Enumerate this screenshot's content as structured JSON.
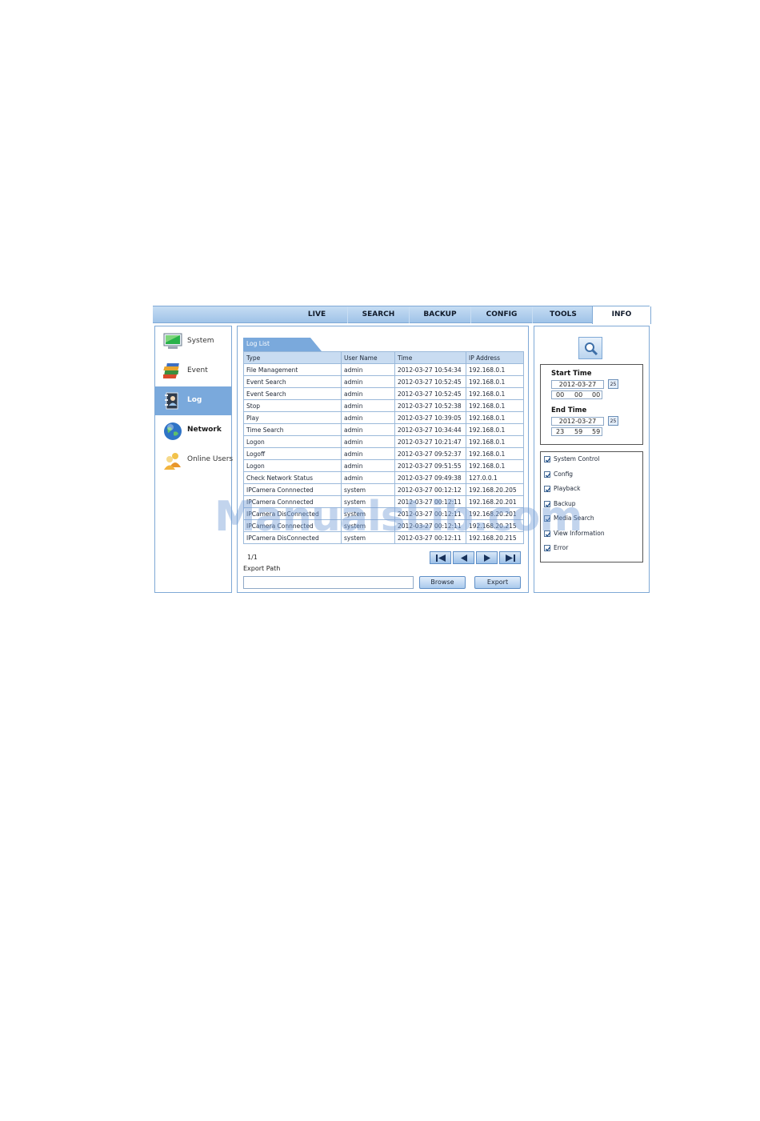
{
  "nav": {
    "tabs": [
      "LIVE",
      "SEARCH",
      "BACKUP",
      "CONFIG",
      "TOOLS",
      "INFO"
    ],
    "active_tab": "INFO"
  },
  "sidebar": {
    "items": [
      {
        "label": "System",
        "icon": "monitor-icon"
      },
      {
        "label": "Event",
        "icon": "books-icon"
      },
      {
        "label": "Log",
        "icon": "log-icon"
      },
      {
        "label": "Network",
        "icon": "globe-icon"
      },
      {
        "label": "Online Users",
        "icon": "users-icon"
      }
    ],
    "active": "Log"
  },
  "log": {
    "tab_label": "Log List",
    "columns": [
      "Type",
      "User Name",
      "Time",
      "IP Address"
    ],
    "rows": [
      [
        "File Management",
        "admin",
        "2012-03-27 10:54:34",
        "192.168.0.1"
      ],
      [
        "Event Search",
        "admin",
        "2012-03-27 10:52:45",
        "192.168.0.1"
      ],
      [
        "Event Search",
        "admin",
        "2012-03-27 10:52:45",
        "192.168.0.1"
      ],
      [
        "Stop",
        "admin",
        "2012-03-27 10:52:38",
        "192.168.0.1"
      ],
      [
        "Play",
        "admin",
        "2012-03-27 10:39:05",
        "192.168.0.1"
      ],
      [
        "Time Search",
        "admin",
        "2012-03-27 10:34:44",
        "192.168.0.1"
      ],
      [
        "Logon",
        "admin",
        "2012-03-27 10:21:47",
        "192.168.0.1"
      ],
      [
        "Logoff",
        "admin",
        "2012-03-27 09:52:37",
        "192.168.0.1"
      ],
      [
        "Logon",
        "admin",
        "2012-03-27 09:51:55",
        "192.168.0.1"
      ],
      [
        "Check Network Status",
        "admin",
        "2012-03-27 09:49:38",
        "127.0.0.1"
      ],
      [
        "IPCamera Connnected",
        "system",
        "2012-03-27 00:12:12",
        "192.168.20.205"
      ],
      [
        "IPCamera Connnected",
        "system",
        "2012-03-27 00:12:11",
        "192.168.20.201"
      ],
      [
        "IPCamera DisConnected",
        "system",
        "2012-03-27 00:12:11",
        "192.168.20.201"
      ],
      [
        "IPCamera Connnected",
        "system",
        "2012-03-27 00:12:11",
        "192.168.20.215"
      ],
      [
        "IPCamera DisConnected",
        "system",
        "2012-03-27 00:12:11",
        "192.168.20.215"
      ]
    ],
    "page": "1/1",
    "export_path_label": "Export Path",
    "export_path_value": "",
    "browse_label": "Browse",
    "export_label": "Export"
  },
  "filter": {
    "start_time_label": "Start Time",
    "start_date": "2012-03-27",
    "start_h": "00",
    "start_m": "00",
    "start_s": "00",
    "end_time_label": "End Time",
    "end_date": "2012-03-27",
    "end_h": "23",
    "end_m": "59",
    "end_s": "59",
    "calendar_label": "25",
    "categories": [
      {
        "label": "System Control",
        "checked": true
      },
      {
        "label": "Config",
        "checked": true
      },
      {
        "label": "Playback",
        "checked": true
      },
      {
        "label": "Backup",
        "checked": true
      },
      {
        "label": "Media Search",
        "checked": true
      },
      {
        "label": "View Information",
        "checked": true
      },
      {
        "label": "Error",
        "checked": true
      }
    ]
  },
  "watermark": "ManualsLib.com",
  "colors": {
    "accent": "#7aa9dc",
    "nav_bg": "#b5d1ee",
    "border": "#7fa9d6"
  }
}
